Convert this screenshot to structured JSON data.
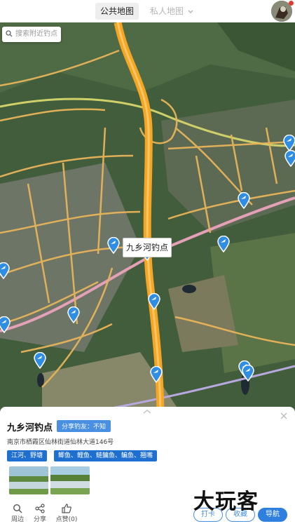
{
  "header": {
    "tab_public": "公共地图",
    "tab_private": "私人地图",
    "private_caret_icon": "chevron-down-icon"
  },
  "search": {
    "placeholder": "搜索附近钓点"
  },
  "map": {
    "selected_label": "九乡河钓点",
    "pin_color": "#2f8ee3"
  },
  "card": {
    "name": "九乡河钓点",
    "share_badge": "分享钓友：不知",
    "address": "南京市栖霞区仙林街道仙林大道146号",
    "tags_water": "江河、野塘",
    "tags_fish": "鲫鱼、鲤鱼、鲢鳙鱼、鳊鱼、翘嘴",
    "actions": {
      "nearby": "周边",
      "share": "分享",
      "like": "点赞(0)"
    },
    "buttons": {
      "checkin": "打卡",
      "favorite": "收藏",
      "navigate": "导航"
    },
    "watermark": "大玩客"
  },
  "colors": {
    "accent": "#2f7fde",
    "tag": "#1e6fd0",
    "road_major": "#f5a623"
  }
}
